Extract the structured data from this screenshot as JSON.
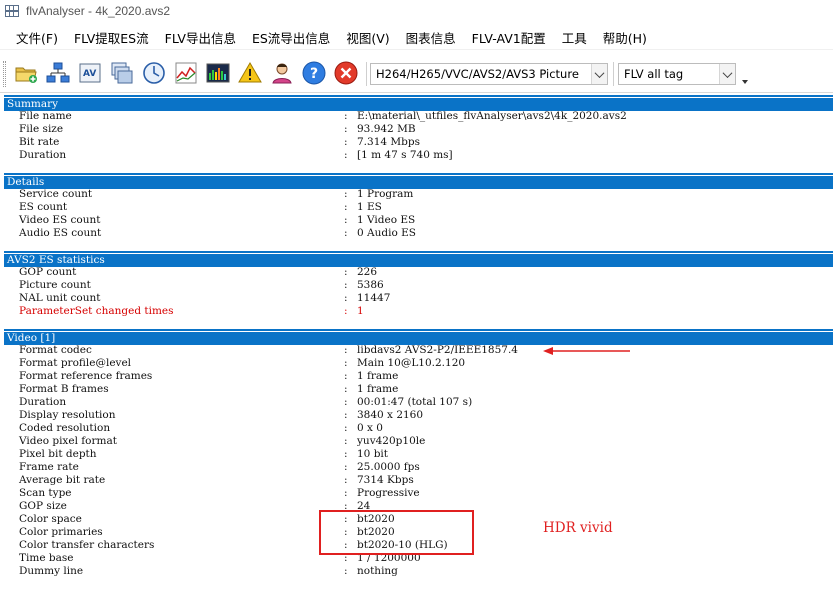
{
  "window": {
    "title": "flvAnalyser - 4k_2020.avs2"
  },
  "menu": [
    "文件(F)",
    "FLV提取ES流",
    "FLV导出信息",
    "ES流导出信息",
    "视图(V)",
    "图表信息",
    "FLV-AV1配置",
    "工具",
    "帮助(H)"
  ],
  "toolbar": {
    "buttons": [
      "open-folder-icon",
      "network-icon",
      "av-text-icon",
      "windows-icon",
      "clock-icon",
      "line-chart-icon",
      "spectrum-icon",
      "warning-icon",
      "user-icon",
      "help-icon",
      "close-icon"
    ],
    "codec_select": "H264/H265/VVC/AVS2/AVS3 Picture",
    "tag_select": "FLV all tag"
  },
  "sections": {
    "summary": {
      "title": "Summary",
      "rows": [
        {
          "k": "File name",
          "v": "E:\\material\\_utfiles_flvAnalyser\\avs2\\4k_2020.avs2"
        },
        {
          "k": "File size",
          "v": "93.942 MB"
        },
        {
          "k": "Bit rate",
          "v": "7.314 Mbps"
        },
        {
          "k": "Duration",
          "v": "[1 m 47 s 740 ms]"
        }
      ]
    },
    "details": {
      "title": "Details",
      "rows": [
        {
          "k": "Service count",
          "v": "1 Program"
        },
        {
          "k": "ES count",
          "v": "1 ES"
        },
        {
          "k": "Video ES count",
          "v": "1 Video ES"
        },
        {
          "k": "Audio ES count",
          "v": "0 Audio ES"
        }
      ]
    },
    "avs2": {
      "title": "AVS2 ES statistics",
      "rows": [
        {
          "k": "GOP count",
          "v": "226"
        },
        {
          "k": "Picture count",
          "v": "5386"
        },
        {
          "k": "NAL unit count",
          "v": "11447"
        },
        {
          "k": "ParameterSet changed times",
          "v": "1"
        }
      ]
    },
    "video": {
      "title": "Video [1]",
      "rows": [
        {
          "k": "Format codec",
          "v": "libdavs2 AVS2-P2/IEEE1857.4"
        },
        {
          "k": "Format profile@level",
          "v": "Main 10@L10.2.120"
        },
        {
          "k": "Format reference frames",
          "v": "1 frame"
        },
        {
          "k": "Format B frames",
          "v": "1 frame"
        },
        {
          "k": "Duration",
          "v": "00:01:47 (total 107 s)"
        },
        {
          "k": "Display resolution",
          "v": "3840 x 2160"
        },
        {
          "k": "Coded resolution",
          "v": "0 x 0"
        },
        {
          "k": "Video pixel format",
          "v": "yuv420p10le"
        },
        {
          "k": "Pixel bit depth",
          "v": "10 bit"
        },
        {
          "k": "Frame rate",
          "v": "25.0000 fps"
        },
        {
          "k": "Average bit rate",
          "v": "7314 Kbps"
        },
        {
          "k": "Scan type",
          "v": "Progressive"
        },
        {
          "k": "GOP size",
          "v": "24"
        },
        {
          "k": "Color space",
          "v": "bt2020"
        },
        {
          "k": "Color primaries",
          "v": "bt2020"
        },
        {
          "k": "Color transfer characters",
          "v": "bt2020-10 (HLG)"
        },
        {
          "k": "Time base",
          "v": "1 / 1200000"
        },
        {
          "k": "Dummy line",
          "v": "nothing"
        }
      ]
    }
  },
  "separator": ":",
  "annotation": {
    "note": "HDR vivid"
  },
  "colors": {
    "header": "#0a73c7",
    "annotation": "#e02020",
    "warning_text": "#d60000"
  }
}
